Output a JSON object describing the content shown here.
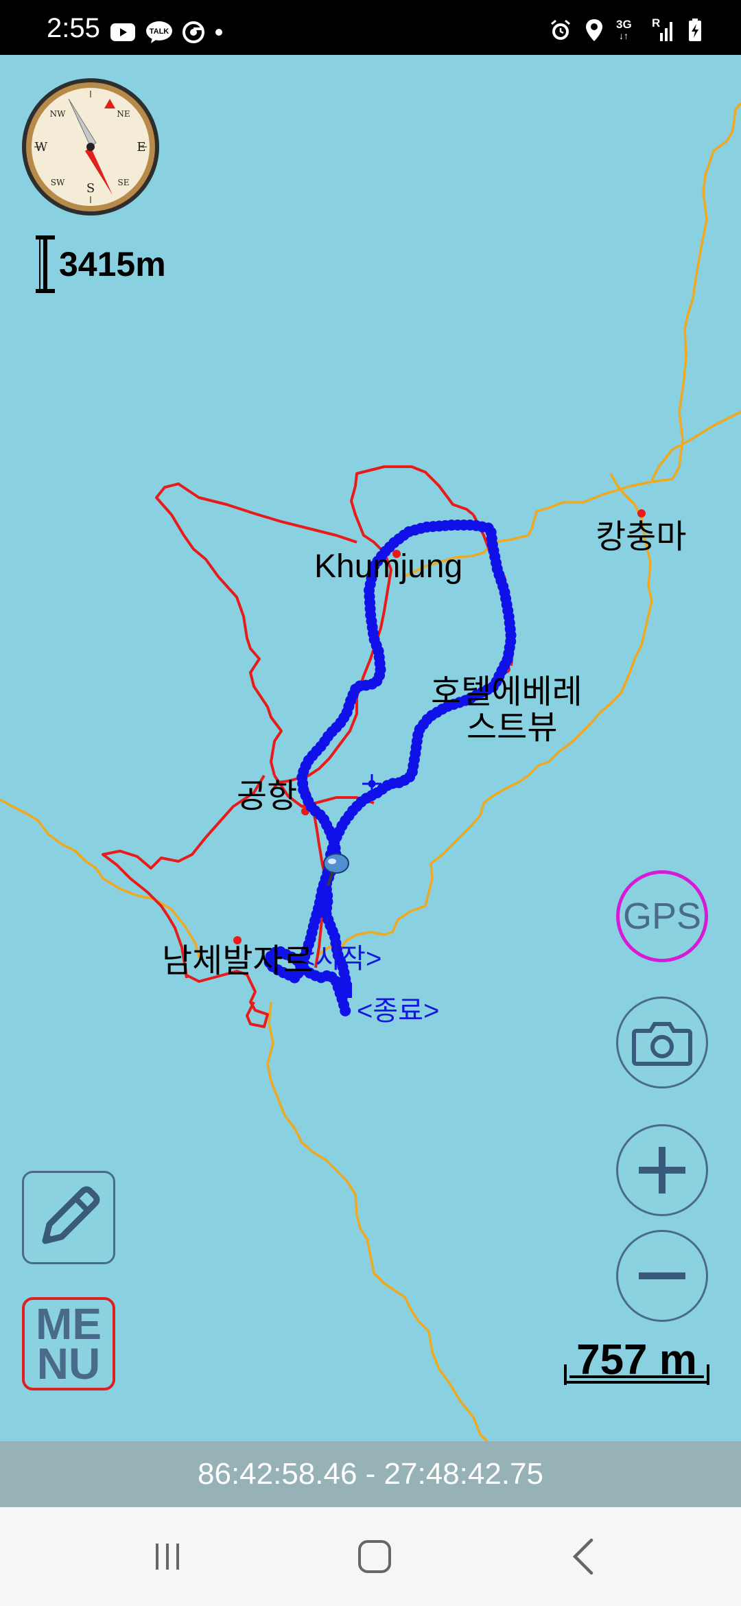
{
  "status_bar": {
    "time": "2:55",
    "left_icons": [
      "youtube-icon",
      "talk-icon",
      "chrome-icon",
      "dot-icon"
    ],
    "right_icons": [
      "alarm-icon",
      "location-icon",
      "3g-icon",
      "signal-icon",
      "battery-charging-icon"
    ],
    "network_label": "3G",
    "roaming_label": "R"
  },
  "map": {
    "altitude": "3415m",
    "labels": {
      "khumjung": "Khumjung",
      "kangchungma": "캉충마",
      "hotel_line1": "호텔에베레",
      "hotel_line2": "스트뷰",
      "airport": "공항",
      "namche": "남체발자르",
      "start": "<시작>",
      "end": "<종료>"
    },
    "colors": {
      "water_background": "#89D1E0",
      "trail": "#E81A1A",
      "road": "#F0A81E",
      "track": "#1010E8"
    }
  },
  "controls": {
    "gps_label": "GPS",
    "menu_line1": "ME",
    "menu_line2": "NU",
    "scale": "757 m"
  },
  "coordinates": "86:42:58.46 - 27:48:42.75",
  "nav_bar": {
    "icons": [
      "recent-apps-icon",
      "home-icon",
      "back-icon"
    ]
  }
}
